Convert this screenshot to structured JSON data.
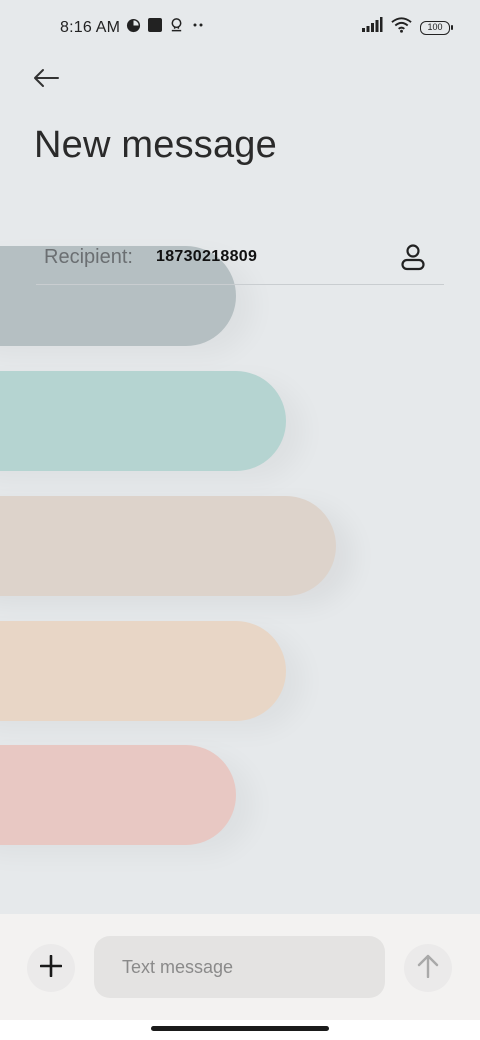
{
  "status_bar": {
    "time": "8:16 AM",
    "battery_level": "100",
    "icons": [
      "app-notification-icon",
      "square-notification-icon",
      "notification-icon",
      "more-icon",
      "signal-icon",
      "wifi-icon",
      "battery-icon"
    ]
  },
  "header": {
    "back_icon": "arrow-left-icon",
    "title": "New message"
  },
  "recipient": {
    "label": "Recipient:",
    "value": "18730218809",
    "contact_icon": "person-icon"
  },
  "decor": {
    "pill_colors": [
      "#b5bfc2",
      "#b5d4d1",
      "#ddd3cb",
      "#e8d6c6",
      "#e8c8c3"
    ]
  },
  "composer": {
    "attach_icon": "plus-icon",
    "input_value": "",
    "input_placeholder": "Text message",
    "send_icon": "arrow-up-icon"
  }
}
